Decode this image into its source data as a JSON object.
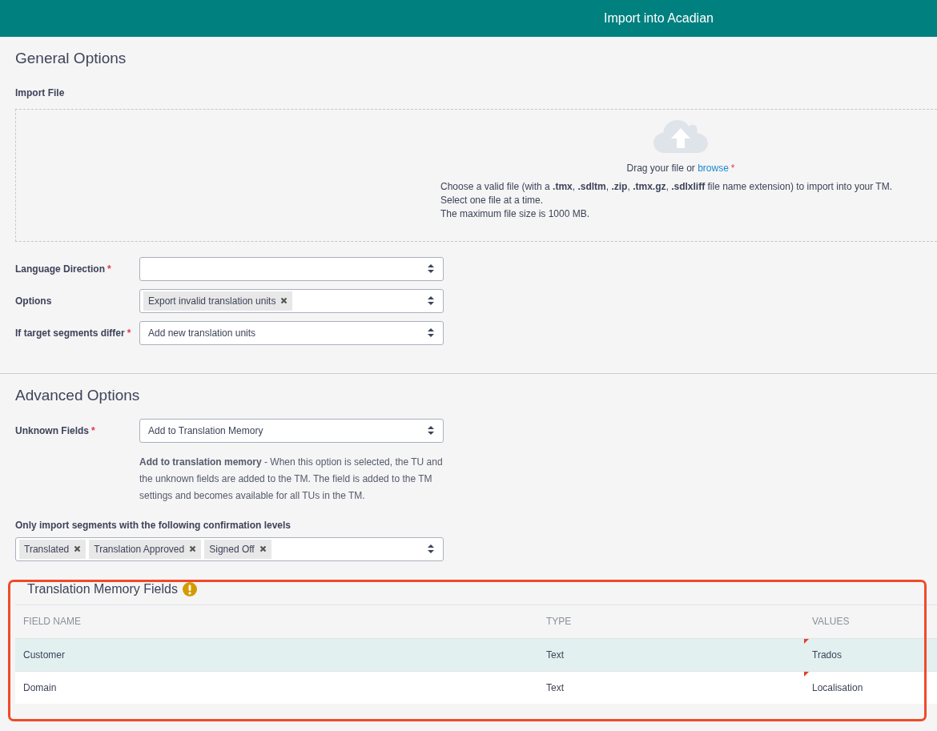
{
  "header": {
    "title": "Import into Acadian"
  },
  "general_options": {
    "heading": "General Options",
    "import_file": {
      "label": "Import File",
      "prompt": "Drag your file or",
      "link": "browse",
      "required_mark": "*",
      "help": [
        "Choose a valid file (with a **.tmx**, **.sdltm**, **.zip**, **.tmx.gz**, **.sdlxliff** file name extension) to import into your TM.",
        "Select one file at a time.",
        "The maximum file size is 1000 MB."
      ]
    },
    "fields": [
      {
        "label": "Language Direction",
        "required_mark": "*",
        "kind": "select"
      },
      {
        "label": "Options",
        "kind": "tags",
        "tags": [
          "Export invalid translation units"
        ]
      },
      {
        "label": "If target segments differ",
        "required_mark": "*",
        "kind": "select",
        "value": "Add new translation units"
      }
    ]
  },
  "advanced_options": {
    "heading": "Advanced Options",
    "unknown_fields": {
      "label": "Unknown Fields",
      "required_mark": "*",
      "kind": "select",
      "value": "Add to Translation Memory",
      "description": "**Add to translation memory** - When this option is selected, the TU and the unknown fields are added to the TM. The field is added to the TM settings and becomes available for all TUs in the TM."
    },
    "confirmation_levels": {
      "label": "Only import segments with the following confirmation levels",
      "tags": [
        "Translated",
        "Translation Approved",
        "Signed Off"
      ]
    }
  },
  "tm_fields": {
    "title": "Translation Memory Fields",
    "columns": [
      "FIELD NAME",
      "TYPE",
      "VALUES"
    ],
    "rows": [
      {
        "selected": true,
        "cells": [
          "Customer",
          "Text",
          "Trados"
        ]
      },
      {
        "selected": false,
        "cells": [
          "Domain",
          "Text",
          "Localisation"
        ]
      }
    ]
  }
}
